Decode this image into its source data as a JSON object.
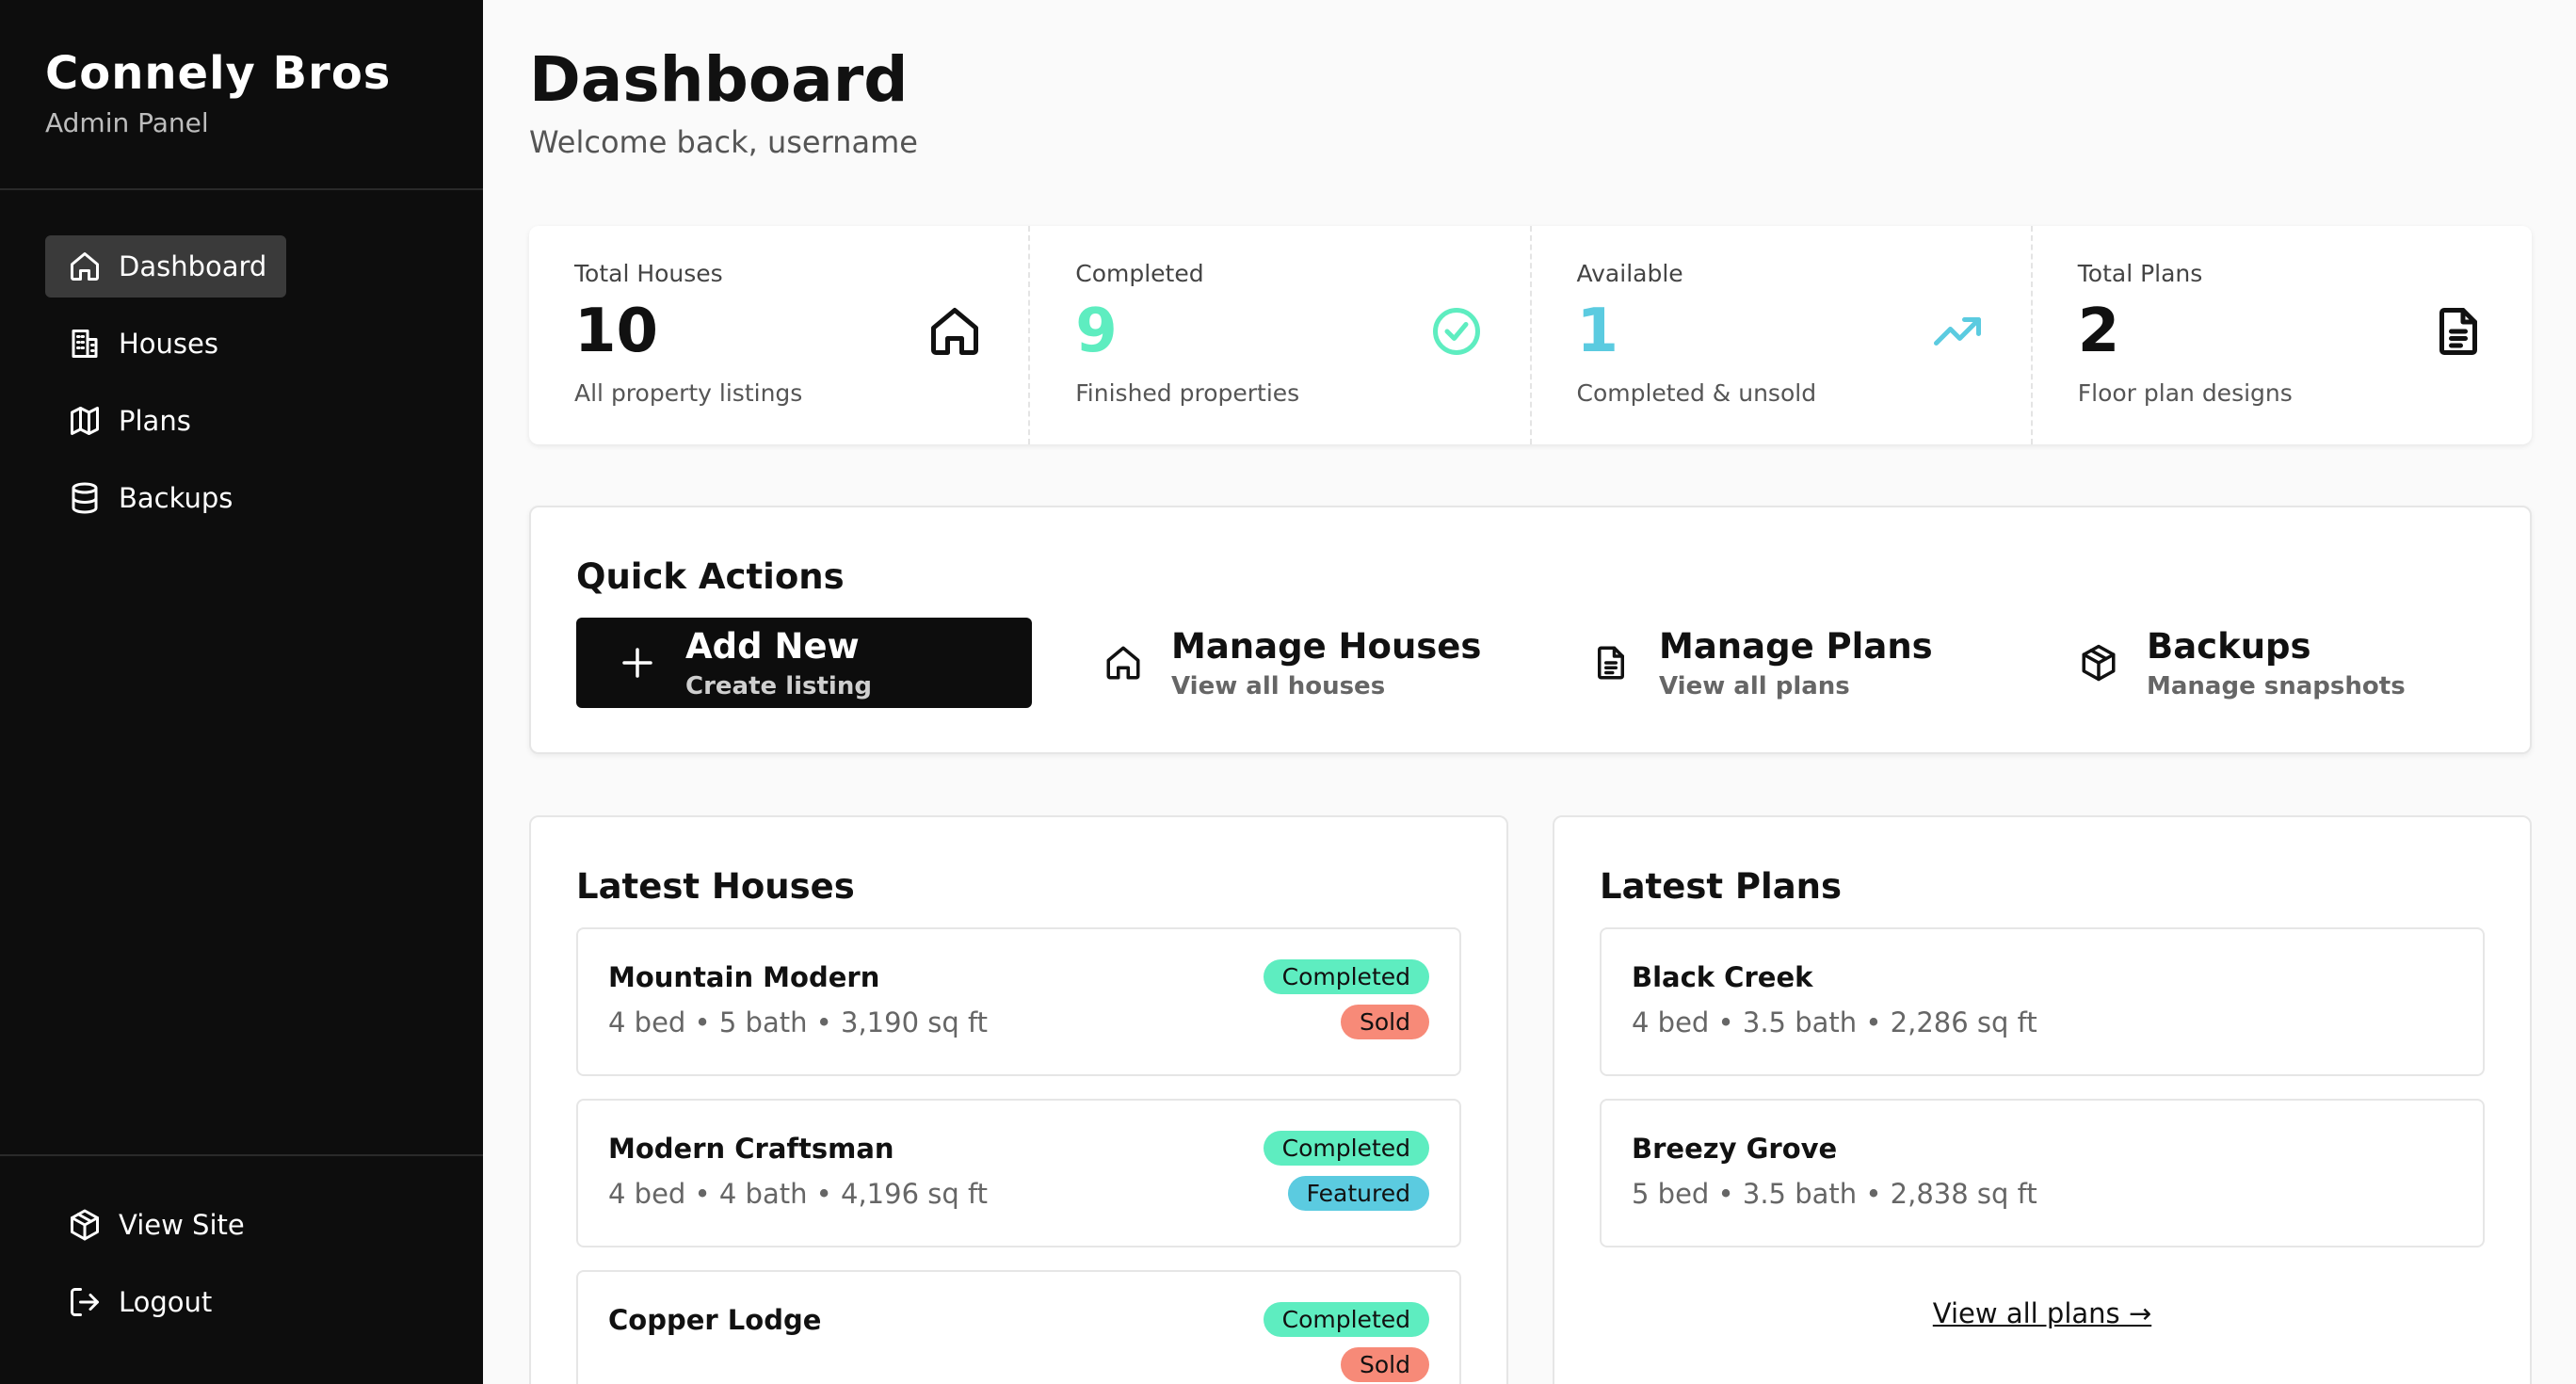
{
  "sidebar": {
    "brand_title": "Connely Bros",
    "brand_sub": "Admin Panel",
    "items": [
      {
        "label": "Dashboard",
        "icon": "home-icon",
        "active": true
      },
      {
        "label": "Houses",
        "icon": "building-icon"
      },
      {
        "label": "Plans",
        "icon": "map-icon"
      },
      {
        "label": "Backups",
        "icon": "database-icon"
      }
    ],
    "bottom_items": [
      {
        "label": "View Site",
        "icon": "box-icon"
      },
      {
        "label": "Logout",
        "icon": "logout-icon"
      }
    ]
  },
  "header": {
    "title": "Dashboard",
    "subtitle": "Welcome back, username"
  },
  "stats": [
    {
      "label": "Total Houses",
      "value": "10",
      "desc": "All property listings",
      "icon": "home-icon",
      "color": "#111111"
    },
    {
      "label": "Completed",
      "value": "9",
      "desc": "Finished properties",
      "icon": "check-circle-icon",
      "color": "#5eedc0"
    },
    {
      "label": "Available",
      "value": "1",
      "desc": "Completed & unsold",
      "icon": "trending-up-icon",
      "color": "#5bcbe0"
    },
    {
      "label": "Total Plans",
      "value": "2",
      "desc": "Floor plan designs",
      "icon": "document-icon",
      "color": "#111111"
    }
  ],
  "quick_actions": {
    "title": "Quick Actions",
    "items": [
      {
        "title": "Add New",
        "sub": "Create listing",
        "icon": "plus-icon"
      },
      {
        "title": "Manage Houses",
        "sub": "View all houses",
        "icon": "home-icon"
      },
      {
        "title": "Manage Plans",
        "sub": "View all plans",
        "icon": "document-icon"
      },
      {
        "title": "Backups",
        "sub": "Manage snapshots",
        "icon": "box-icon"
      }
    ]
  },
  "latest_houses": {
    "title": "Latest Houses",
    "items": [
      {
        "name": "Mountain Modern",
        "meta": "4 bed • 5 bath • 3,190 sq ft",
        "badges": [
          "Completed",
          "Sold"
        ]
      },
      {
        "name": "Modern Craftsman",
        "meta": "4 bed • 4 bath • 4,196 sq ft",
        "badges": [
          "Completed",
          "Featured"
        ]
      },
      {
        "name": "Copper Lodge",
        "meta": "",
        "badges": [
          "Completed",
          "Sold"
        ]
      }
    ]
  },
  "latest_plans": {
    "title": "Latest Plans",
    "items": [
      {
        "name": "Black Creek",
        "meta": "4 bed • 3.5 bath • 2,286 sq ft"
      },
      {
        "name": "Breezy Grove",
        "meta": "5 bed • 3.5 bath • 2,838 sq ft"
      }
    ],
    "view_all": "View all plans →"
  }
}
